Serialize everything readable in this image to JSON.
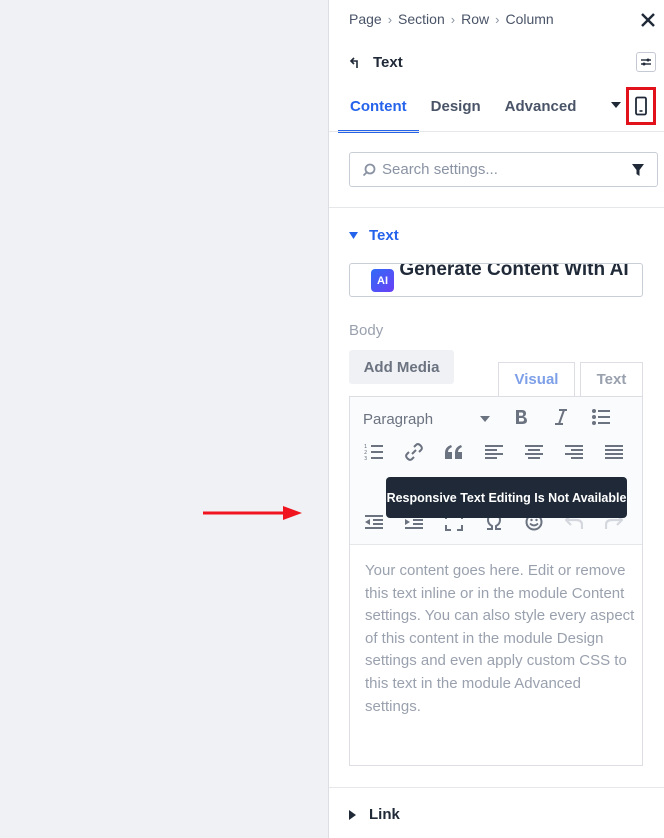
{
  "breadcrumb": [
    "Page",
    "Section",
    "Row",
    "Column"
  ],
  "breadcrumb_separator": "›",
  "module": {
    "title": "Text"
  },
  "tabs": [
    {
      "label": "Content",
      "active": true
    },
    {
      "label": "Design",
      "active": false
    },
    {
      "label": "Advanced",
      "active": false
    }
  ],
  "search": {
    "placeholder": "Search settings..."
  },
  "group": {
    "label": "Text",
    "expanded": true
  },
  "ai": {
    "badge": "AI",
    "label": "Generate Content With AI"
  },
  "body_field": {
    "label": "Body",
    "add_media": "Add Media",
    "editor_tabs": {
      "visual": "Visual",
      "text": "Text"
    },
    "paragraph_select": "Paragraph",
    "tooltip": "Responsive Text Editing Is Not Available",
    "content": "Your content goes here. Edit or remove this text inline or in the module Content settings. You can also style every aspect of this content in the module Design settings and even apply custom CSS to this text in the module Advanced settings."
  },
  "link_group": {
    "label": "Link",
    "expanded": false
  },
  "colors": {
    "accent": "#2563eb",
    "highlight": "#e1121c",
    "arrow": "#f0141e"
  },
  "icons": [
    "close-icon",
    "back-arrow-icon",
    "options-icon",
    "caret-down-icon",
    "responsive-mobile-icon",
    "search-icon",
    "filter-icon",
    "bold-icon",
    "italic-icon",
    "bullet-list-icon",
    "ordered-list-icon",
    "link-icon",
    "blockquote-icon",
    "align-left-icon",
    "align-center-icon",
    "align-right-icon",
    "justify-icon",
    "outdent-icon",
    "indent-icon",
    "fullscreen-icon",
    "special-char-icon",
    "emoji-icon",
    "undo-icon",
    "redo-icon",
    "arrow-right-icon"
  ]
}
